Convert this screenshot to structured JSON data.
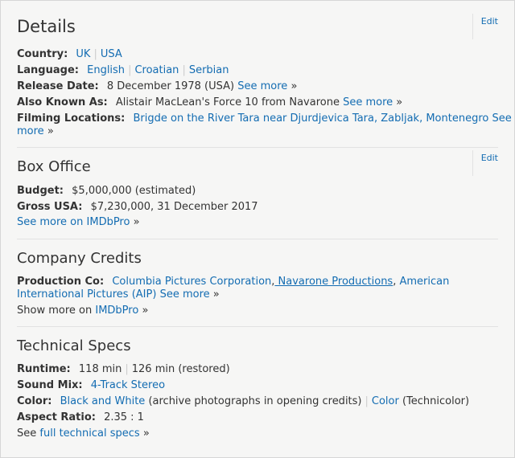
{
  "details": {
    "title": "Details",
    "edit": "Edit",
    "country": {
      "label": "Country:",
      "values": [
        "UK",
        "USA"
      ]
    },
    "language": {
      "label": "Language:",
      "values": [
        "English",
        "Croatian",
        "Serbian"
      ]
    },
    "release": {
      "label": "Release Date:",
      "value": "8 December 1978 (USA)",
      "more": "See more",
      "raquo": "»"
    },
    "aka": {
      "label": "Also Known As:",
      "value": "Alistair MacLean's Force 10 from Navarone",
      "more": "See more",
      "raquo": "»"
    },
    "filming": {
      "label": "Filming Locations:",
      "value": "Brigde on the River Tara near Djurdjevica Tara, Zabljak, Montenegro",
      "more_a": "See",
      "more_b": "more",
      "raquo": "»"
    }
  },
  "box_office": {
    "title": "Box Office",
    "edit": "Edit",
    "budget": {
      "label": "Budget:",
      "value": "$5,000,000 (estimated)"
    },
    "gross": {
      "label": "Gross USA:",
      "value": "$7,230,000, 31 December 2017"
    },
    "more": "See more on IMDbPro",
    "raquo": "»"
  },
  "company": {
    "title": "Company Credits",
    "production": {
      "label": "Production Co:",
      "c1": "Columbia Pictures Corporation",
      "comma1": ",",
      "c2": " Navarone Productions",
      "comma2": ",",
      "c3a": "American",
      "c3b": "International Pictures (AIP)",
      "more": "See more",
      "raquo": "»"
    },
    "show_more_text": "Show more on",
    "show_more_link": "IMDbPro",
    "raquo": "»"
  },
  "tech": {
    "title": "Technical Specs",
    "runtime": {
      "label": "Runtime:",
      "v1": "118 min",
      "v2": "126 min (restored)"
    },
    "sound": {
      "label": "Sound Mix:",
      "value": "4-Track Stereo"
    },
    "color": {
      "label": "Color:",
      "v1": "Black and White",
      "v1_note": " (archive photographs in opening credits)",
      "v2": "Color",
      "v2_note": " (Technicolor)"
    },
    "aspect": {
      "label": "Aspect Ratio:",
      "value": "2.35 : 1"
    },
    "see_text": "See",
    "see_link": "full technical specs",
    "raquo": "»"
  }
}
